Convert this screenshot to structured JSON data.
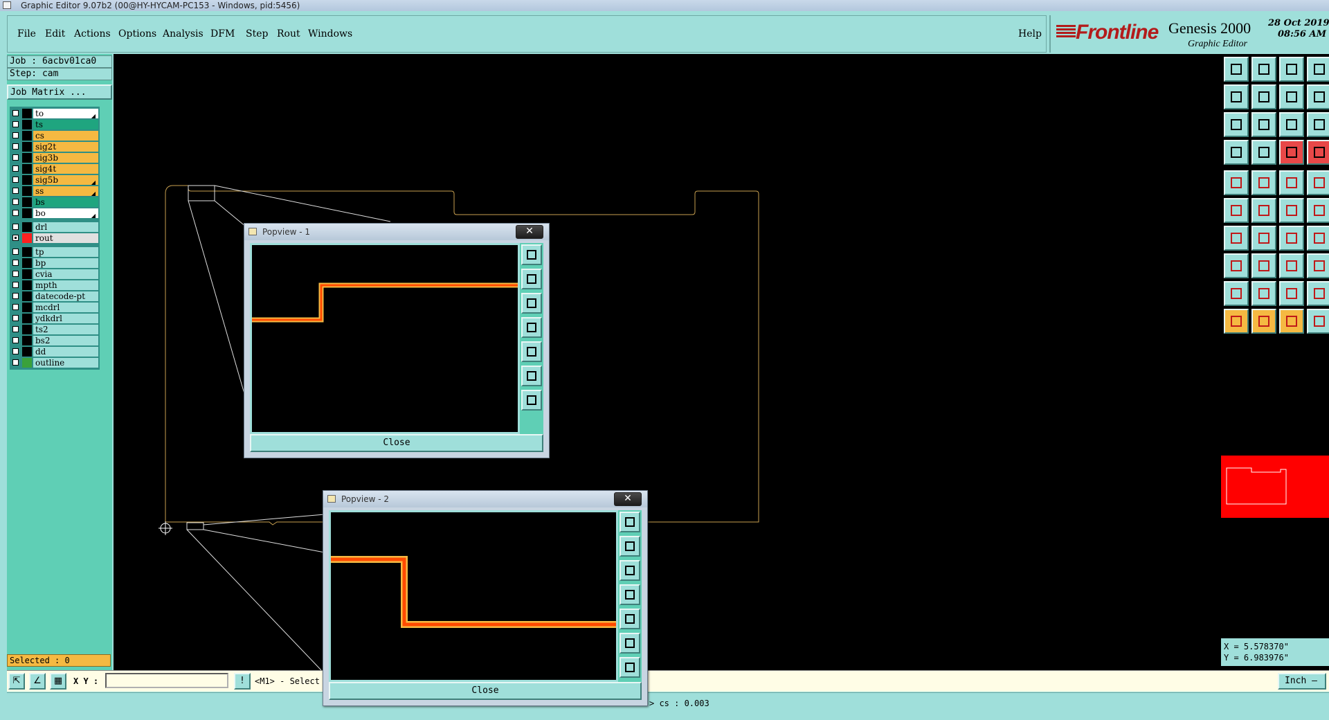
{
  "window": {
    "title": "Graphic Editor 9.07b2 (00@HY-HYCAM-PC153 - Windows, pid:5456)"
  },
  "menu": {
    "items": [
      "File",
      "Edit",
      "Actions",
      "Options",
      "Analysis",
      "DFM",
      "Step",
      "Rout",
      "Windows"
    ],
    "help": "Help"
  },
  "brand": {
    "logo": "Frontline",
    "product": "Genesis 2000",
    "subtitle": "Graphic Editor",
    "date": "28 Oct 2019",
    "time": "08:56 AM"
  },
  "job": {
    "job_label": "Job : 6acbv01ca0",
    "step_label": "Step: cam",
    "matrix_button": "Job Matrix ..."
  },
  "layers": [
    {
      "name": "to",
      "color": "#ffffff",
      "arrow": true
    },
    {
      "name": "ts",
      "color": "#1fa57f",
      "arrow": false
    },
    {
      "name": "cs",
      "color": "#f5b942",
      "arrow": false
    },
    {
      "name": "sig2t",
      "color": "#f5b942",
      "arrow": false
    },
    {
      "name": "sig3b",
      "color": "#f5b942",
      "arrow": false
    },
    {
      "name": "sig4t",
      "color": "#f5b942",
      "arrow": false
    },
    {
      "name": "sig5b",
      "color": "#f5b942",
      "arrow": true
    },
    {
      "name": "ss",
      "color": "#f5b942",
      "arrow": true
    },
    {
      "name": "bs",
      "color": "#1fa57f",
      "arrow": false
    },
    {
      "name": "bo",
      "color": "#ffffff",
      "arrow": true
    }
  ],
  "drill_layers": [
    {
      "name": "drl",
      "color": "#9fdfda",
      "swatch": "#000000",
      "checked": false
    },
    {
      "name": "rout",
      "color": "#e0e0e0",
      "swatch": "#ff2020",
      "checked": true
    }
  ],
  "misc_layers": [
    {
      "name": "tp",
      "swatch": "#000000"
    },
    {
      "name": "bp",
      "swatch": "#000000"
    },
    {
      "name": "cvia",
      "swatch": "#000000"
    },
    {
      "name": "mpth",
      "swatch": "#000000"
    },
    {
      "name": "datecode-pt",
      "swatch": "#000000"
    },
    {
      "name": "mcdrl",
      "swatch": "#000000"
    },
    {
      "name": "ydkdrl",
      "swatch": "#000000"
    },
    {
      "name": "ts2",
      "swatch": "#000000"
    },
    {
      "name": "bs2",
      "swatch": "#000000"
    },
    {
      "name": "dd",
      "swatch": "#000000"
    },
    {
      "name": "outline",
      "swatch": "#3aa13a"
    }
  ],
  "selected": "Selected : 0",
  "coords": {
    "x": "X = 5.578370\"",
    "y": "Y = 6.983976\""
  },
  "bottom": {
    "xy_label": "X Y :",
    "xy_value": "",
    "message": "<M1> - Select f",
    "unit": "Inch —"
  },
  "status": {
    "text": "> cs : 0.003"
  },
  "popview1": {
    "title": "Popview - 1",
    "close": "Close"
  },
  "popview2": {
    "title": "Popview - 2",
    "close": "Close"
  },
  "colors": {
    "background": "#000000",
    "panel": "#9fdfda",
    "panel_dark": "#5fcfb5",
    "trace": "#ff4a00",
    "trace_edge": "#f5b942",
    "outline": "#c8a050"
  }
}
